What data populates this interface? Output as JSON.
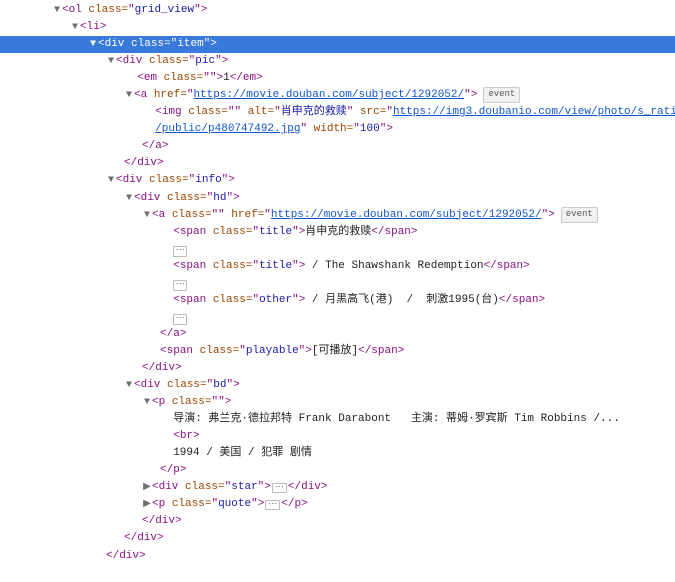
{
  "badges": {
    "event": "event"
  },
  "tree": {
    "ol": {
      "tag": "ol",
      "class": "grid_view"
    },
    "li": {
      "tag": "li"
    },
    "item": {
      "tag": "div",
      "class": "item"
    },
    "pic": {
      "tag": "div",
      "class": "pic"
    },
    "em": {
      "tag": "em",
      "class": "",
      "text": "1"
    },
    "a_pic": {
      "tag": "a",
      "href": "https://movie.douban.com/subject/1292052/"
    },
    "img": {
      "tag": "img",
      "class": "",
      "alt": "肖申克的救赎",
      "src_line1": "https://img3.doubanio.com/view/photo/s_ratio_poster",
      "src_line2": "/public/p480747492.jpg",
      "width": "100"
    },
    "info": {
      "tag": "div",
      "class": "info"
    },
    "hd": {
      "tag": "div",
      "class": "hd"
    },
    "a_hd": {
      "tag": "a",
      "class": "",
      "href": "https://movie.douban.com/subject/1292052/"
    },
    "title1": {
      "tag": "span",
      "class": "title",
      "text": "肖申克的救赎"
    },
    "title2": {
      "tag": "span",
      "class": "title",
      "text": " / The Shawshank Redemption"
    },
    "other": {
      "tag": "span",
      "class": "other",
      "text": " / 月黑高飞(港)  /  刺激1995(台)"
    },
    "playable": {
      "tag": "span",
      "class": "playable",
      "text": "[可播放]"
    },
    "bd": {
      "tag": "div",
      "class": "bd"
    },
    "p": {
      "tag": "p",
      "class": "",
      "line1": "导演: 弗兰克·德拉邦特 Frank Darabont   主演: 蒂姆·罗宾斯 Tim Robbins /...",
      "line2": "1994 / 美国 / 犯罪 剧情"
    },
    "star": {
      "tag": "div",
      "class": "star"
    },
    "quote": {
      "tag": "p",
      "class": "quote"
    }
  }
}
